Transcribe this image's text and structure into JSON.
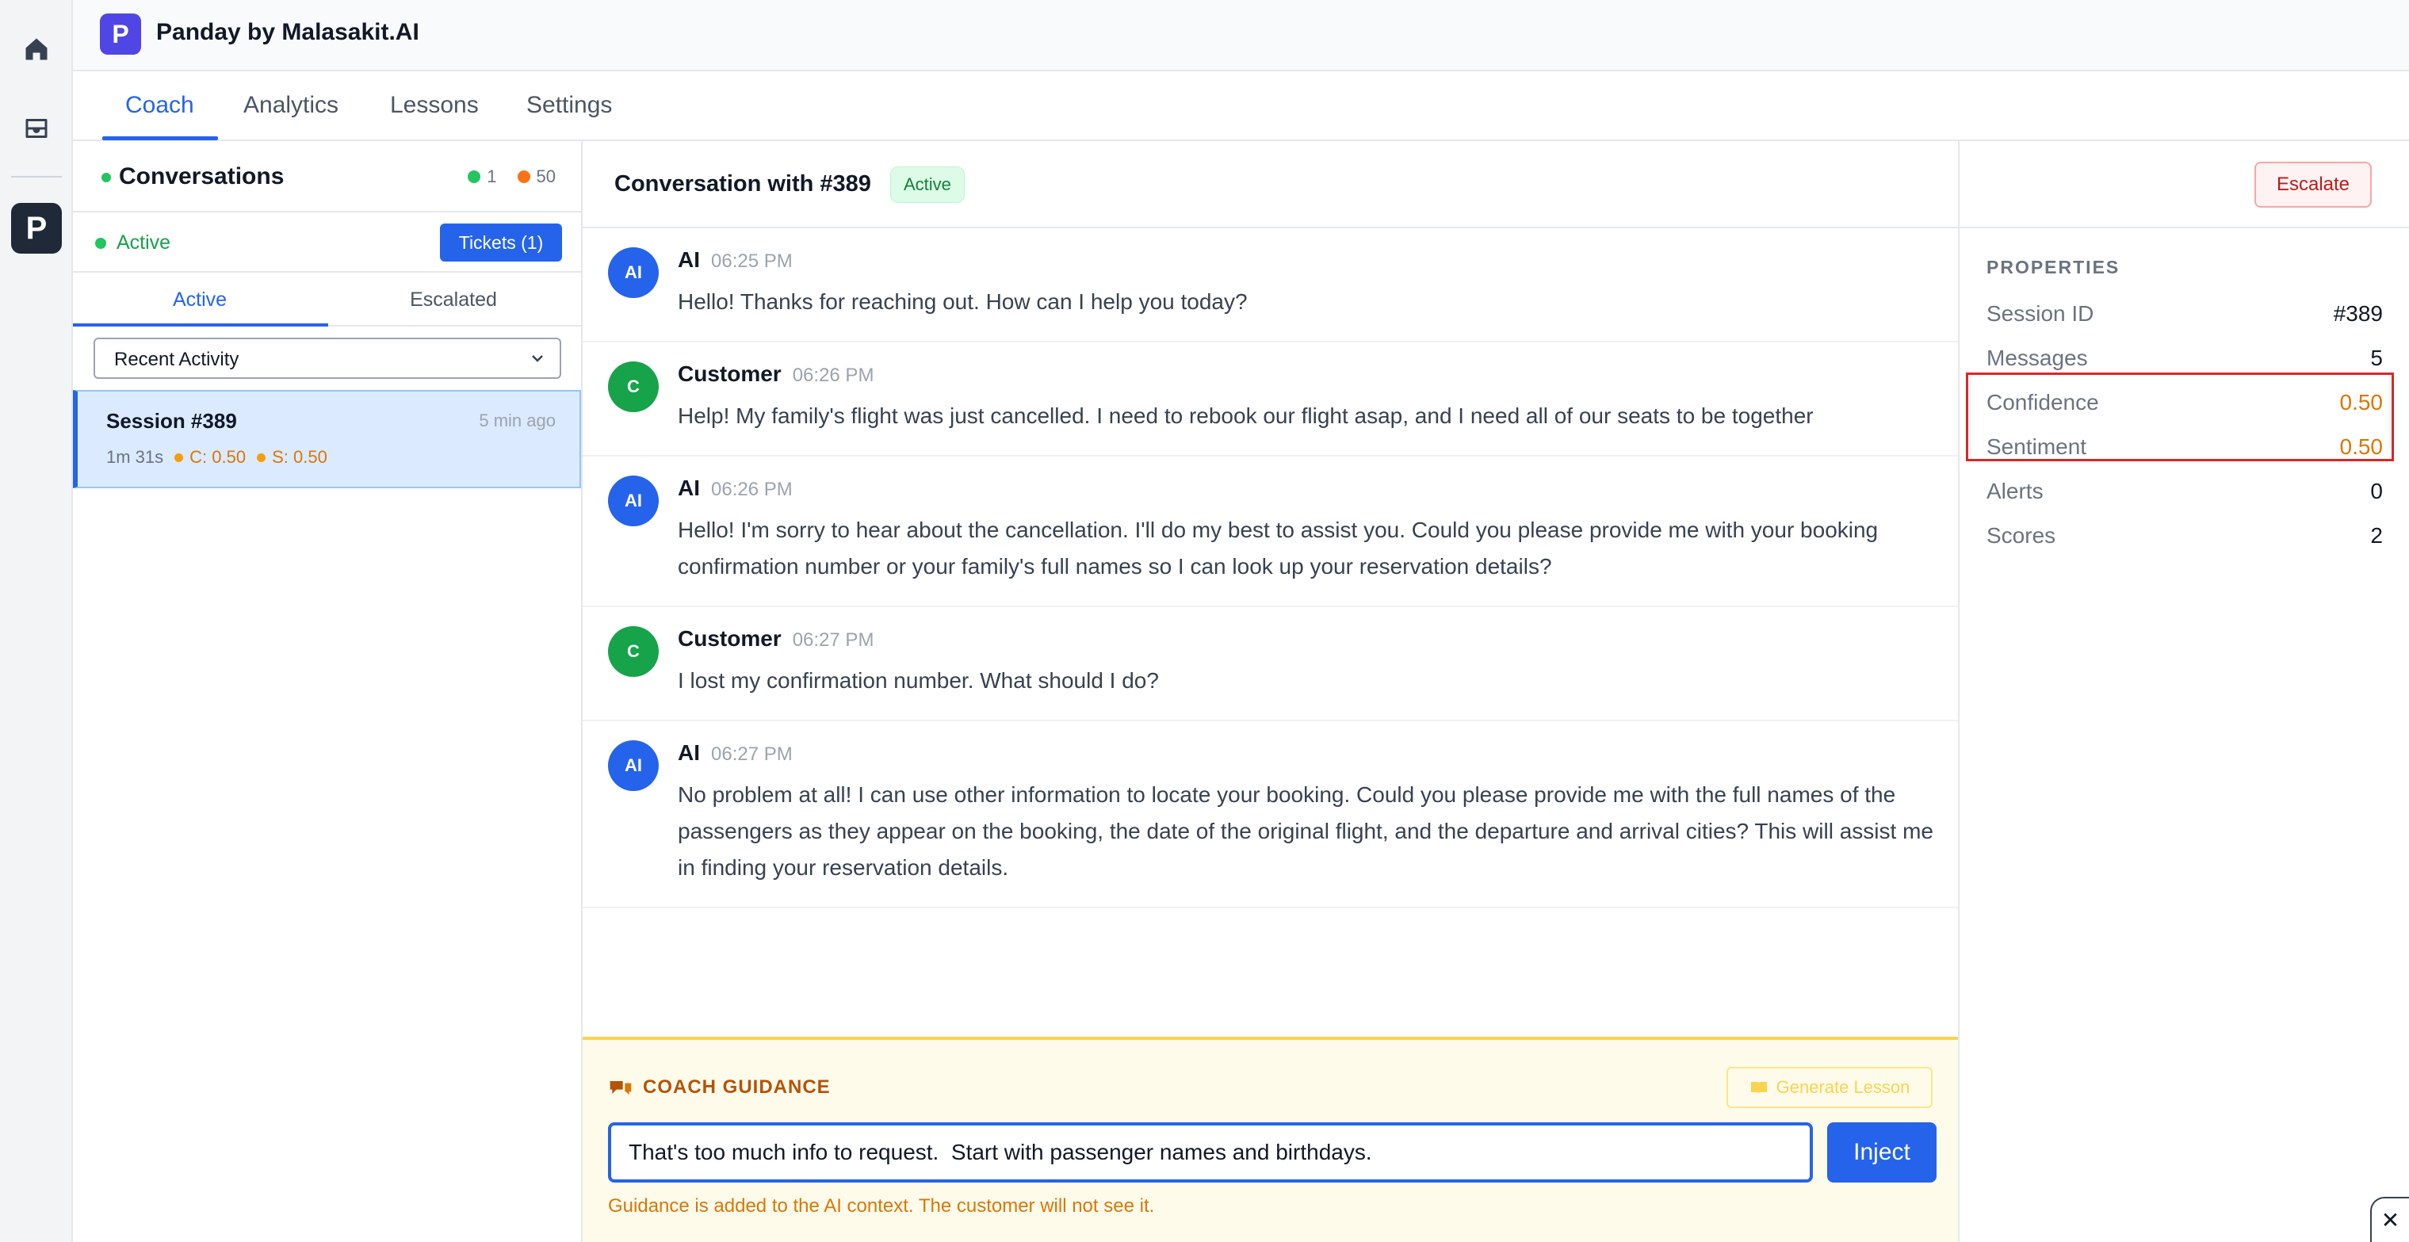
{
  "rail": {
    "items": [
      {
        "name": "home-icon"
      },
      {
        "name": "inbox-icon"
      },
      {
        "label": "P"
      }
    ]
  },
  "header": {
    "logo_letter": "P",
    "title": "Panday by Malasakit.AI"
  },
  "nav": {
    "tabs": [
      {
        "label": "Coach",
        "active": true
      },
      {
        "label": "Analytics",
        "active": false
      },
      {
        "label": "Lessons",
        "active": false
      },
      {
        "label": "Settings",
        "active": false
      }
    ]
  },
  "conversations": {
    "title": "Conversations",
    "count_green": "1",
    "count_orange": "50",
    "status_label": "Active",
    "tickets_label": "Tickets (1)",
    "subtabs": [
      "Active",
      "Escalated"
    ],
    "sort_value": "Recent Activity",
    "sessions": [
      {
        "title": "Session #389",
        "ago": "5 min ago",
        "duration": "1m 31s",
        "confidence": "C: 0.50",
        "sentiment": "S: 0.50"
      }
    ]
  },
  "chat": {
    "title": "Conversation with #389",
    "status_badge": "Active",
    "escalate_label": "Escalate",
    "messages": [
      {
        "sender": "AI",
        "avatar": "AI",
        "time": "06:25 PM",
        "text": "Hello! Thanks for reaching out. How can I help you today?"
      },
      {
        "sender": "Customer",
        "avatar": "C",
        "time": "06:26 PM",
        "text": "Help!  My family's flight was just cancelled.  I need to rebook our flight asap, and I need all of our seats to be together"
      },
      {
        "sender": "AI",
        "avatar": "AI",
        "time": "06:26 PM",
        "text": "Hello! I'm sorry to hear about the cancellation. I'll do my best to assist you. Could you please provide me with your booking confirmation number or your family's full names so I can look up your reservation details?"
      },
      {
        "sender": "Customer",
        "avatar": "C",
        "time": "06:27 PM",
        "text": "I lost my confirmation number. What should I do?"
      },
      {
        "sender": "AI",
        "avatar": "AI",
        "time": "06:27 PM",
        "text": "No problem at all! I can use other information to locate your booking. Could you please provide me with the full names of the passengers as they appear on the booking, the date of the original flight, and the departure and arrival cities? This will assist me in finding your reservation details."
      }
    ]
  },
  "coach": {
    "label": "COACH GUIDANCE",
    "generate_label": "Generate Lesson",
    "input_value": "That's too much info to request.  Start with passenger names and birthdays. ",
    "inject_label": "Inject",
    "note": "Guidance is added to the AI context. The customer will not see it."
  },
  "properties": {
    "heading": "PROPERTIES",
    "rows": [
      {
        "key": "Session ID",
        "value": "#389"
      },
      {
        "key": "Messages",
        "value": "5"
      },
      {
        "key": "Confidence",
        "value": "0.50"
      },
      {
        "key": "Sentiment",
        "value": "0.50"
      },
      {
        "key": "Alerts",
        "value": "0"
      },
      {
        "key": "Scores",
        "value": "2"
      }
    ]
  },
  "colors": {
    "accent": "#2563eb",
    "success": "#16a34a",
    "warning": "#d97706",
    "danger": "#dc2626",
    "brand": "#4f46e5"
  },
  "corner": {
    "close_glyph": "✕"
  }
}
